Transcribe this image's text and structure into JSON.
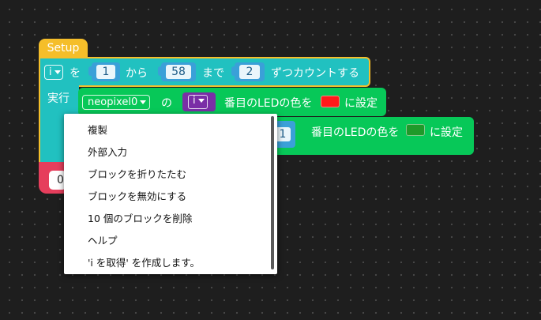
{
  "setup_block": {
    "title": "Setup",
    "loop_var": "i",
    "wo": "を",
    "from_value": "1",
    "kara": "から",
    "to_value": "58",
    "made": "まで",
    "step_value": "2",
    "count_label": "ずつカウントする",
    "do_label": "実行",
    "footer_value": "0"
  },
  "neopixel_block_1": {
    "device": "neopixel0",
    "no": "の",
    "index_var": "i",
    "led_text": "番目のLEDの色を",
    "color": "#ff1a1a",
    "set_text": "に設定"
  },
  "neopixel_block_2": {
    "index_value": "1",
    "led_text": "番目のLEDの色を",
    "color": "#1f9a2a",
    "set_text": "に設定"
  },
  "context_menu": {
    "items": [
      "複製",
      "外部入力",
      "ブロックを折りたたむ",
      "ブロックを無効にする",
      "10 個のブロックを削除",
      "ヘルプ",
      "'i を取得' を作成します。"
    ]
  },
  "colors": {
    "workspace_bg": "#1e1e1e",
    "setup_yellow": "#f5be2a",
    "loop_teal": "#21c1c0",
    "neopixel_green": "#07c858",
    "number_blue": "#3aa0d8",
    "variable_purple": "#7a2ea6",
    "footer_red": "#e63e5c"
  },
  "icons": {
    "dropdown": "chevron-down-icon"
  }
}
